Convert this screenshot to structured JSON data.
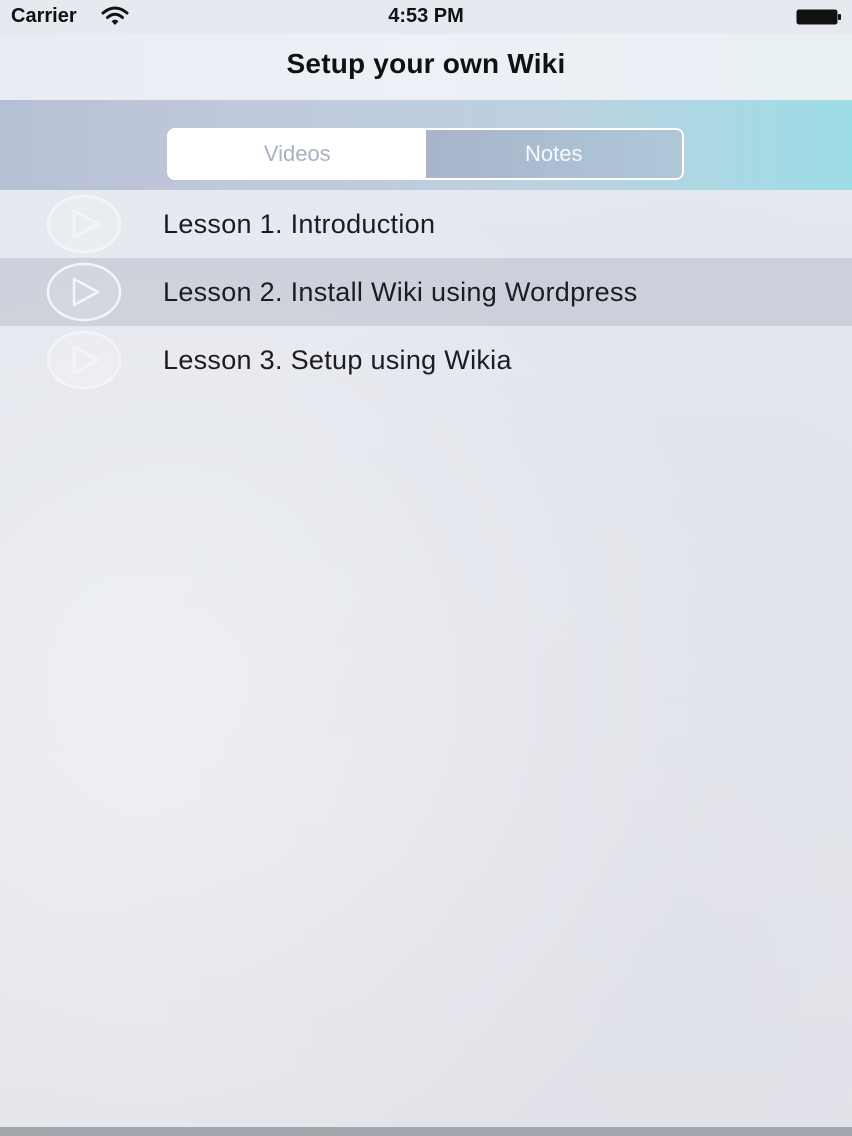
{
  "status_bar": {
    "carrier": "Carrier",
    "time": "4:53 PM",
    "wifi_icon": "wifi-icon",
    "battery_icon": "battery-icon"
  },
  "nav": {
    "title": "Setup your own Wiki"
  },
  "segments": {
    "videos": "Videos",
    "notes": "Notes",
    "selected": "Videos"
  },
  "lessons": [
    {
      "label": "Lesson 1. Introduction",
      "icon": "play-icon",
      "selected": false
    },
    {
      "label": "Lesson 2. Install Wiki using Wordpress",
      "icon": "play-icon",
      "selected": true
    },
    {
      "label": "Lesson 3. Setup using Wikia",
      "icon": "play-icon",
      "selected": false
    }
  ],
  "colors": {
    "segment_band_start": "#b6c0d4",
    "segment_band_end": "#9ddde6",
    "selected_row": "#c4c8d2",
    "text_primary": "#1c1c22"
  }
}
